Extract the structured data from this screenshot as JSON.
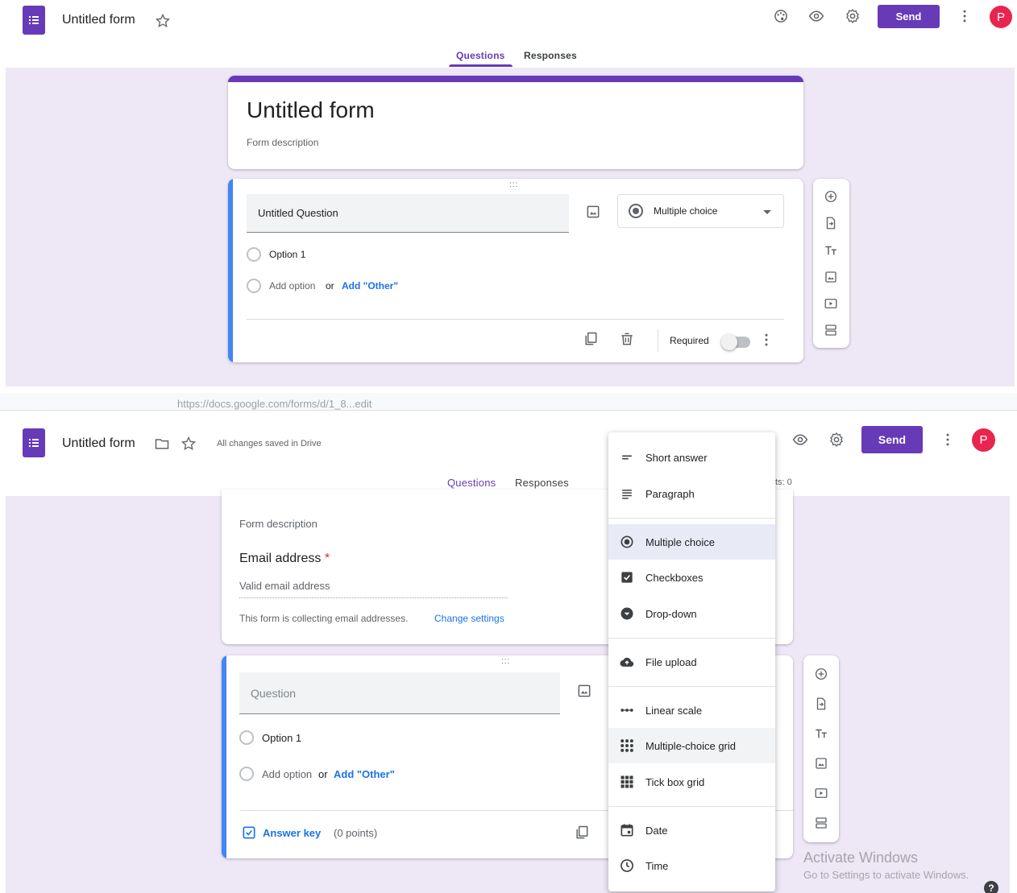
{
  "top": {
    "title": "Untitled form",
    "tabs": [
      "Questions",
      "Responses"
    ],
    "send_label": "Send",
    "avatar_letter": "P",
    "form": {
      "title": "Untitled form",
      "description": "Form description"
    },
    "question": {
      "title": "Untitled Question",
      "type_label": "Multiple choice",
      "option1": "Option 1",
      "add_option": "Add option",
      "or": "or",
      "add_other": "Add \"Other\"",
      "required_label": "Required"
    }
  },
  "bottom": {
    "url_fragment": "https://docs.google.com/forms/d/1_8...edit",
    "title": "Untitled form",
    "save_status": "All changes saved in Drive",
    "tabs": [
      "Questions",
      "Responses"
    ],
    "points_fragment": "ts: 0",
    "send_label": "Send",
    "avatar_letter": "P",
    "form_description": "Form description",
    "email_label": "Email address",
    "email_required_mark": "*",
    "email_placeholder": "Valid email address",
    "collecting_text": "This form is collecting email addresses.",
    "change_settings": "Change settings",
    "question": {
      "placeholder": "Question",
      "option1": "Option 1",
      "add_option": "Add option",
      "or": "or",
      "add_other": "Add \"Other\"",
      "answer_key": "Answer key",
      "points": "(0 points)"
    },
    "menu": [
      {
        "label": "Short answer",
        "icon": "short-answer-icon"
      },
      {
        "label": "Paragraph",
        "icon": "paragraph-icon"
      },
      {
        "label": "Multiple choice",
        "icon": "radio-icon"
      },
      {
        "label": "Checkboxes",
        "icon": "checkbox-icon"
      },
      {
        "label": "Drop-down",
        "icon": "dropdown-icon"
      },
      {
        "label": "File upload",
        "icon": "cloud-upload-icon"
      },
      {
        "label": "Linear scale",
        "icon": "linear-scale-icon"
      },
      {
        "label": "Multiple-choice grid",
        "icon": "grid-dots-icon"
      },
      {
        "label": "Tick box grid",
        "icon": "grid-squares-icon"
      },
      {
        "label": "Date",
        "icon": "calendar-icon"
      },
      {
        "label": "Time",
        "icon": "clock-icon"
      }
    ],
    "watermark": {
      "title": "Activate Windows",
      "subtitle": "Go to Settings to activate Windows."
    }
  },
  "colors": {
    "accent": "#673ab7",
    "question_accent": "#4285f4",
    "background": "#ede7f6",
    "avatar": "#e8254f",
    "link": "#1a73e8"
  }
}
